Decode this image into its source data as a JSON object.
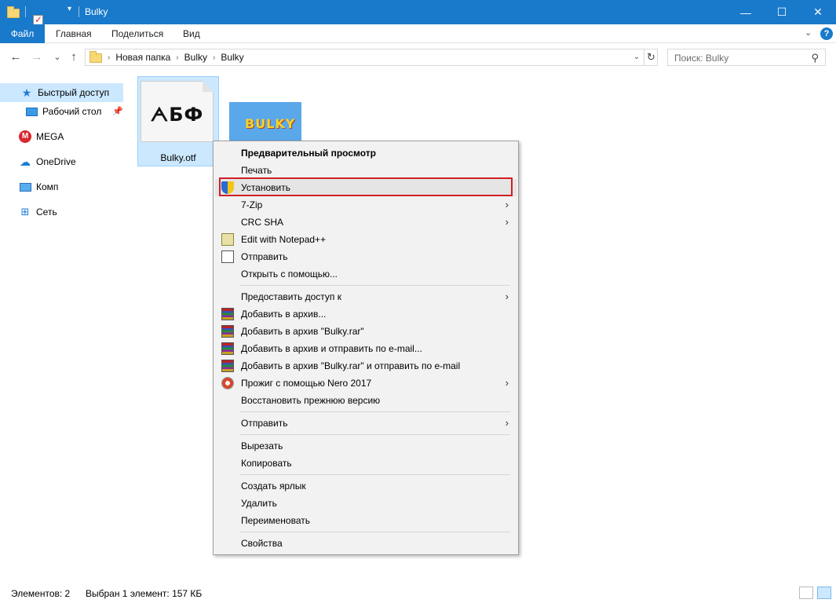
{
  "window": {
    "title": "Bulky",
    "minimize_icon": "—",
    "maximize_icon": "☐",
    "close_icon": "✕"
  },
  "ribbon": {
    "tabs": [
      "Файл",
      "Главная",
      "Поделиться",
      "Вид"
    ],
    "collapse_icon": "⌄",
    "help_icon": "?"
  },
  "nav": {
    "back_icon": "←",
    "forward_icon": "→",
    "recent_icon": "⌄",
    "up_icon": "↑",
    "breadcrumbs": [
      "Новая папка",
      "Bulky",
      "Bulky"
    ],
    "crumb_sep": "›",
    "dropdown_icon": "⌄",
    "refresh_icon": "↻",
    "search_placeholder": "Поиск: Bulky",
    "search_icon": "⚲"
  },
  "sidebar": {
    "items": [
      {
        "label": "Быстрый доступ",
        "icon": "star-icon"
      },
      {
        "label": "Рабочий стол",
        "icon": "desktop-icon"
      },
      {
        "label": "MEGA",
        "icon": "mega-icon"
      },
      {
        "label": "OneDrive",
        "icon": "cloud-icon"
      },
      {
        "label": "Комп",
        "icon": "computer-icon"
      },
      {
        "label": "Сеть",
        "icon": "network-icon"
      }
    ],
    "star_glyph": "★",
    "pin_glyph": "📌",
    "mega_glyph": "M",
    "cloud_glyph": "☁",
    "network_glyph": "⊞"
  },
  "files": [
    {
      "name": "Bulky.otf",
      "preview": "ᗅБФ"
    },
    {
      "name": "",
      "preview": "BULKY"
    }
  ],
  "context_menu": {
    "items": [
      {
        "label": "Предварительный просмотр",
        "bold": true
      },
      {
        "label": "Печать"
      },
      {
        "label": "Установить",
        "highlighted": true
      },
      {
        "label": "7-Zip",
        "submenu": true
      },
      {
        "label": "CRC SHA",
        "submenu": true
      },
      {
        "label": "Edit with Notepad++"
      },
      {
        "label": "Отправить"
      },
      {
        "label": "Открыть с помощью..."
      },
      {
        "label": "Предоставить доступ к",
        "submenu": true
      },
      {
        "label": "Добавить в архив..."
      },
      {
        "label": "Добавить в архив \"Bulky.rar\""
      },
      {
        "label": "Добавить в архив и отправить по e-mail..."
      },
      {
        "label": "Добавить в архив \"Bulky.rar\" и отправить по e-mail"
      },
      {
        "label": "Прожиг с помощью Nero 2017",
        "submenu": true
      },
      {
        "label": "Восстановить прежнюю версию"
      },
      {
        "label": "Отправить",
        "submenu": true
      },
      {
        "label": "Вырезать"
      },
      {
        "label": "Копировать"
      },
      {
        "label": "Создать ярлык"
      },
      {
        "label": "Удалить"
      },
      {
        "label": "Переименовать"
      },
      {
        "label": "Свойства"
      }
    ],
    "arrow_glyph": "›",
    "highlight_color": "#d11f26"
  },
  "status": {
    "items_count": "Элементов: 2",
    "selection": "Выбран 1 элемент: 157 КБ"
  },
  "colors": {
    "accent": "#1979ca",
    "selection": "#cce8ff"
  }
}
